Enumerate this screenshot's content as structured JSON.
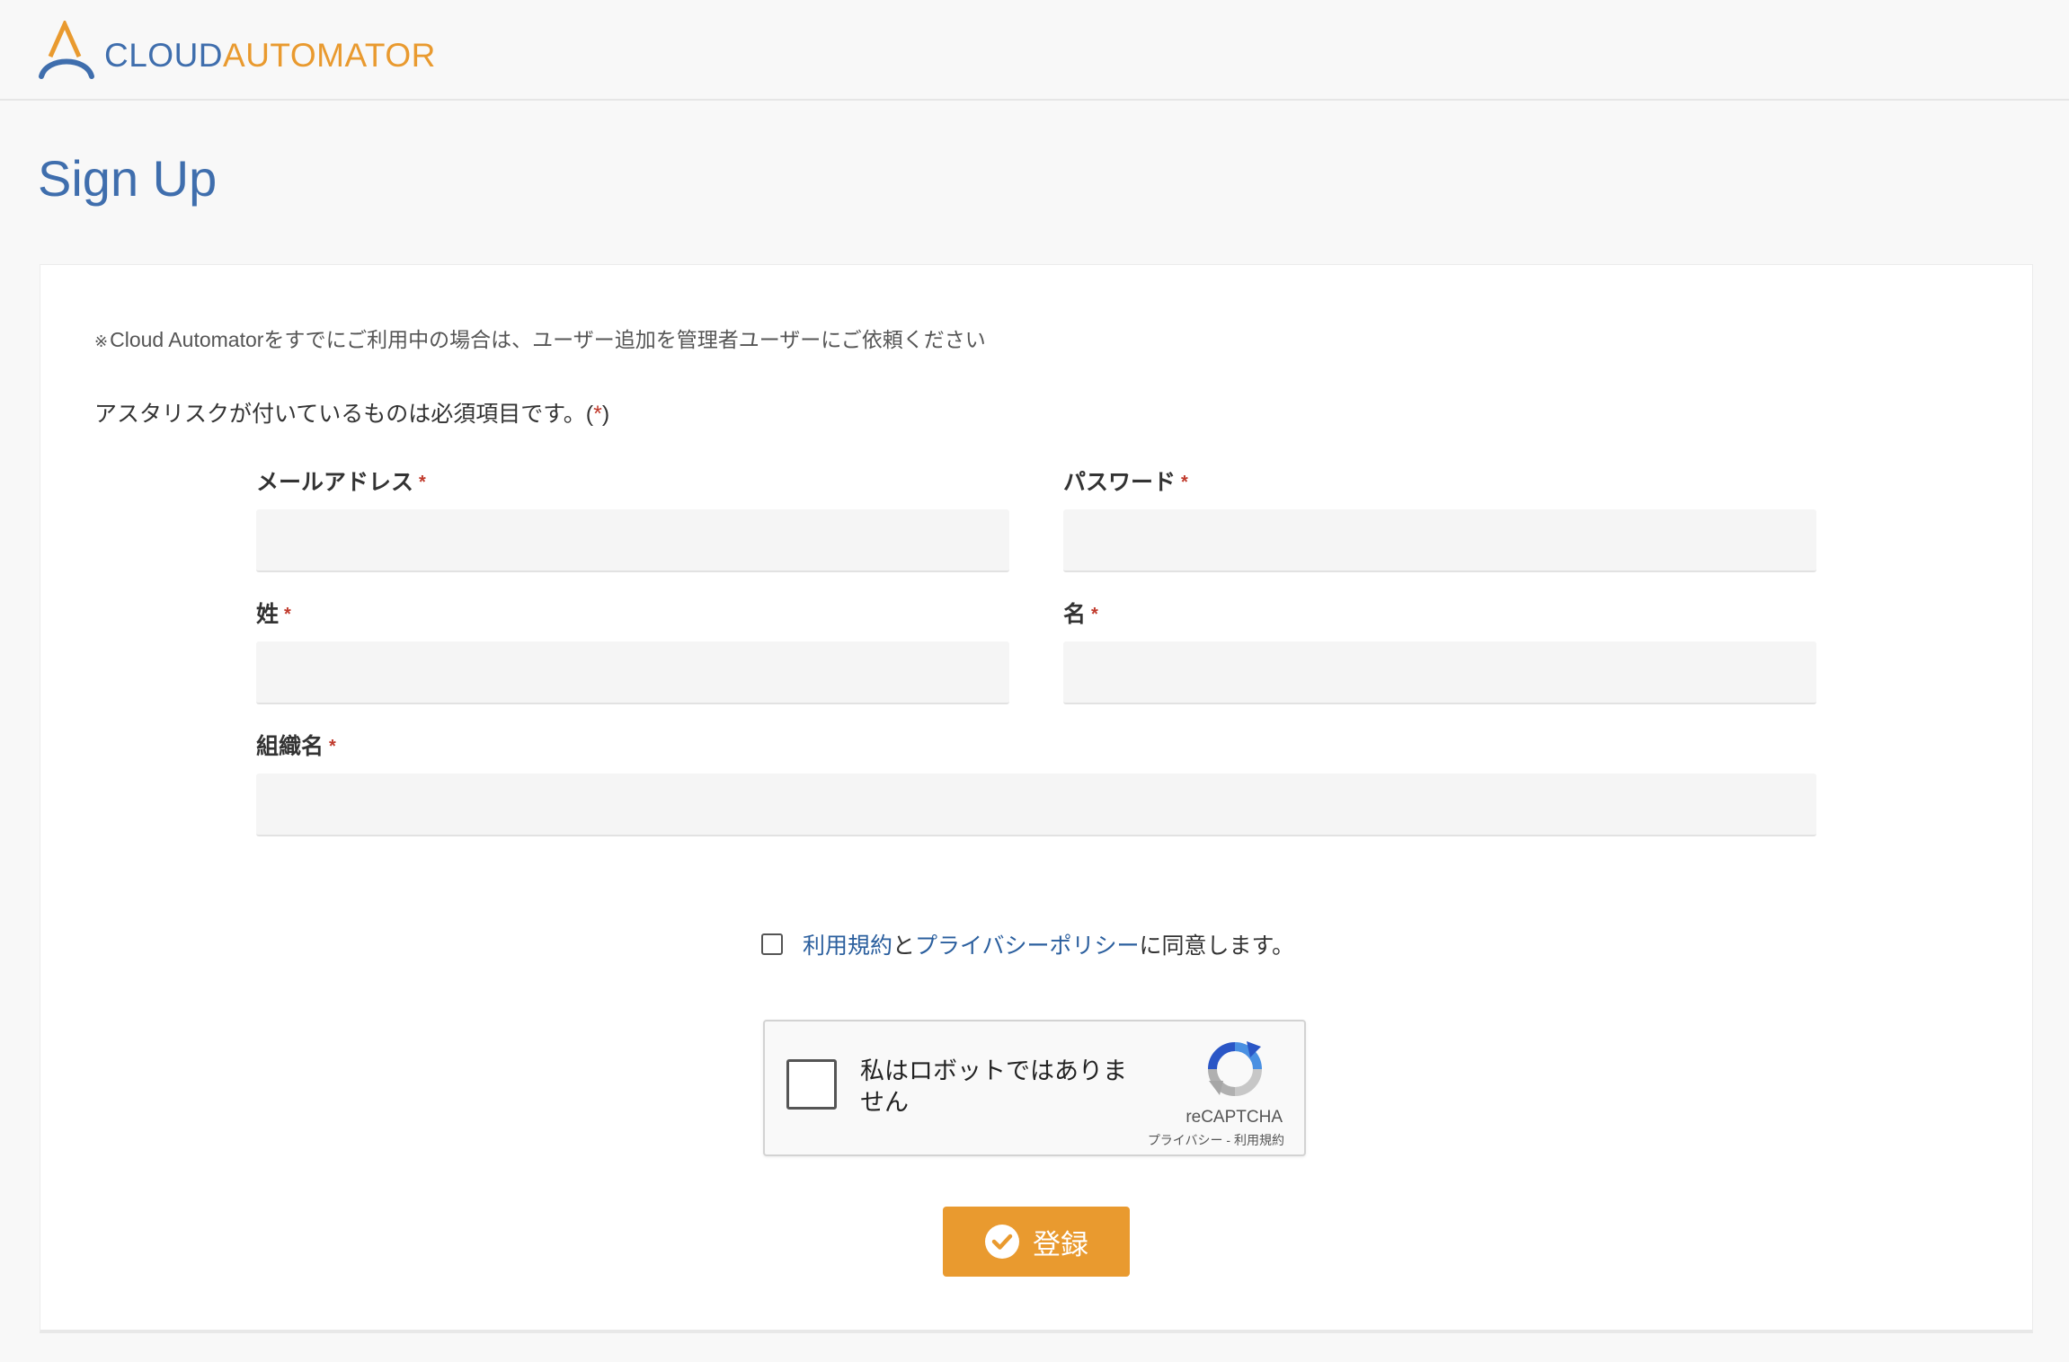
{
  "header": {
    "logo_cloud": "CLOUD",
    "logo_automator": "AUTOMATOR"
  },
  "page": {
    "title": "Sign Up"
  },
  "form": {
    "note_mark": "※",
    "note": "Cloud Automatorをすでにご利用中の場合は、ユーザー追加を管理者ユーザーにご依頼ください",
    "required_note": "アスタリスクが付いているものは必須項目です。(",
    "required_mark": "*",
    "required_close": ")",
    "fields": {
      "email": {
        "label": "メールアドレス",
        "required": "*",
        "value": ""
      },
      "password": {
        "label": "パスワード",
        "required": "*",
        "value": ""
      },
      "last_name": {
        "label": "姓",
        "required": "*",
        "value": ""
      },
      "first_name": {
        "label": "名",
        "required": "*",
        "value": ""
      },
      "organization": {
        "label": "組織名",
        "required": "*",
        "value": ""
      }
    },
    "agree": {
      "terms_link": "利用規約",
      "and": "と",
      "privacy_link": "プライバシーポリシー",
      "suffix": "に同意します。",
      "checked": false
    },
    "recaptcha": {
      "label": "私はロボットではありません",
      "brand": "reCAPTCHA",
      "privacy": "プライバシー",
      "separator": " - ",
      "terms": "利用規約",
      "checked": false
    },
    "submit_label": "登録"
  },
  "colors": {
    "brand_blue": "#3f6ead",
    "brand_orange": "#e99a2f",
    "link_blue": "#2b5f9e",
    "required_red": "#c0392b"
  },
  "icons": {
    "logo": "cloudautomator-logo-icon",
    "recaptcha": "recaptcha-icon",
    "submit": "check-circle-icon"
  }
}
